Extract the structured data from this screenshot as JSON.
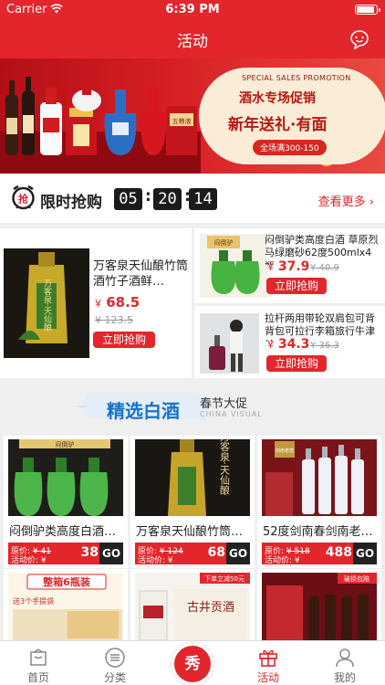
{
  "status_bar": {
    "carrier": "Carrier",
    "time": "6:39 PM"
  },
  "nav": {
    "title": "活动",
    "chat_icon": "chat-bubble-icon"
  },
  "banner": {
    "promo_en": "SPECIAL SALES PROMOTION",
    "line1": "酒水专场促销",
    "line2": "新年送礼·有面",
    "line3": "全场满300-150",
    "bottle_brand": "五粮液"
  },
  "flash_sale": {
    "title": "限时抢购",
    "icon": "alarm-clock-icon",
    "icon_char": "抢",
    "hours": "05",
    "minutes": "20",
    "seconds": "14",
    "more_label": "查看更多",
    "items": [
      {
        "name": "万客泉天仙酿竹筒酒竹子酒鲜…",
        "currency": "¥",
        "price": "68.5",
        "old_price": "123.5",
        "buy_label": "立即抢购",
        "image_text": "万客泉·天仙酿"
      },
      {
        "name": "闷倒驴类高度白酒 草原烈马绿磨砂62度500mlx4瓶…",
        "currency": "¥",
        "price": "37.9",
        "old_price": "40.9",
        "buy_label": "立即抢购",
        "image_text": "闷倒驴"
      },
      {
        "name": "拉杆两用带轮双肩包可背背包可拉行李箱旅行牛津纺…",
        "currency": "¥",
        "price": "34.3",
        "old_price": "36.3",
        "buy_label": "立即抢购",
        "image_text": ""
      }
    ]
  },
  "section": {
    "title": "精选白酒",
    "subtitle": "春节大促",
    "subtitle_en": "CHINA VISUAL"
  },
  "grid": [
    {
      "name": "闷倒驴类高度白酒…",
      "old_label": "原价:",
      "old_currency": "¥",
      "old_price": "41",
      "cur_label": "活动价: ¥",
      "price": "38",
      "go": "GO",
      "image_text": "闷倒驴"
    },
    {
      "name": "万客泉天仙酿竹筒…",
      "old_label": "原价:",
      "old_currency": "¥",
      "old_price": "124",
      "cur_label": "活动价: ¥",
      "price": "68",
      "go": "GO",
      "image_text": "万客泉·天仙酿"
    },
    {
      "name": "52度剑南春剑南老…",
      "old_label": "原价:",
      "old_currency": "¥",
      "old_price": "518",
      "cur_label": "活动价: ¥",
      "price": "488",
      "go": "GO",
      "image_text": "剑南老窖"
    }
  ],
  "grid_row2": [
    {
      "badge": "整箱6瓶装",
      "tag": "送3个手提袋"
    },
    {
      "badge": "下单立减50元",
      "brand": "古井贡酒"
    },
    {
      "badge": "破损包赔"
    }
  ],
  "tabbar": {
    "items": [
      {
        "label": "首页",
        "icon": "home-icon"
      },
      {
        "label": "分类",
        "icon": "category-icon"
      },
      {
        "label": "活动",
        "icon": "gift-icon"
      },
      {
        "label": "我的",
        "icon": "user-icon"
      }
    ],
    "center_label": "秀"
  },
  "colors": {
    "accent": "#e2262b",
    "section_title": "#1a71c9",
    "countdown_bg": "#1b1b1b"
  }
}
